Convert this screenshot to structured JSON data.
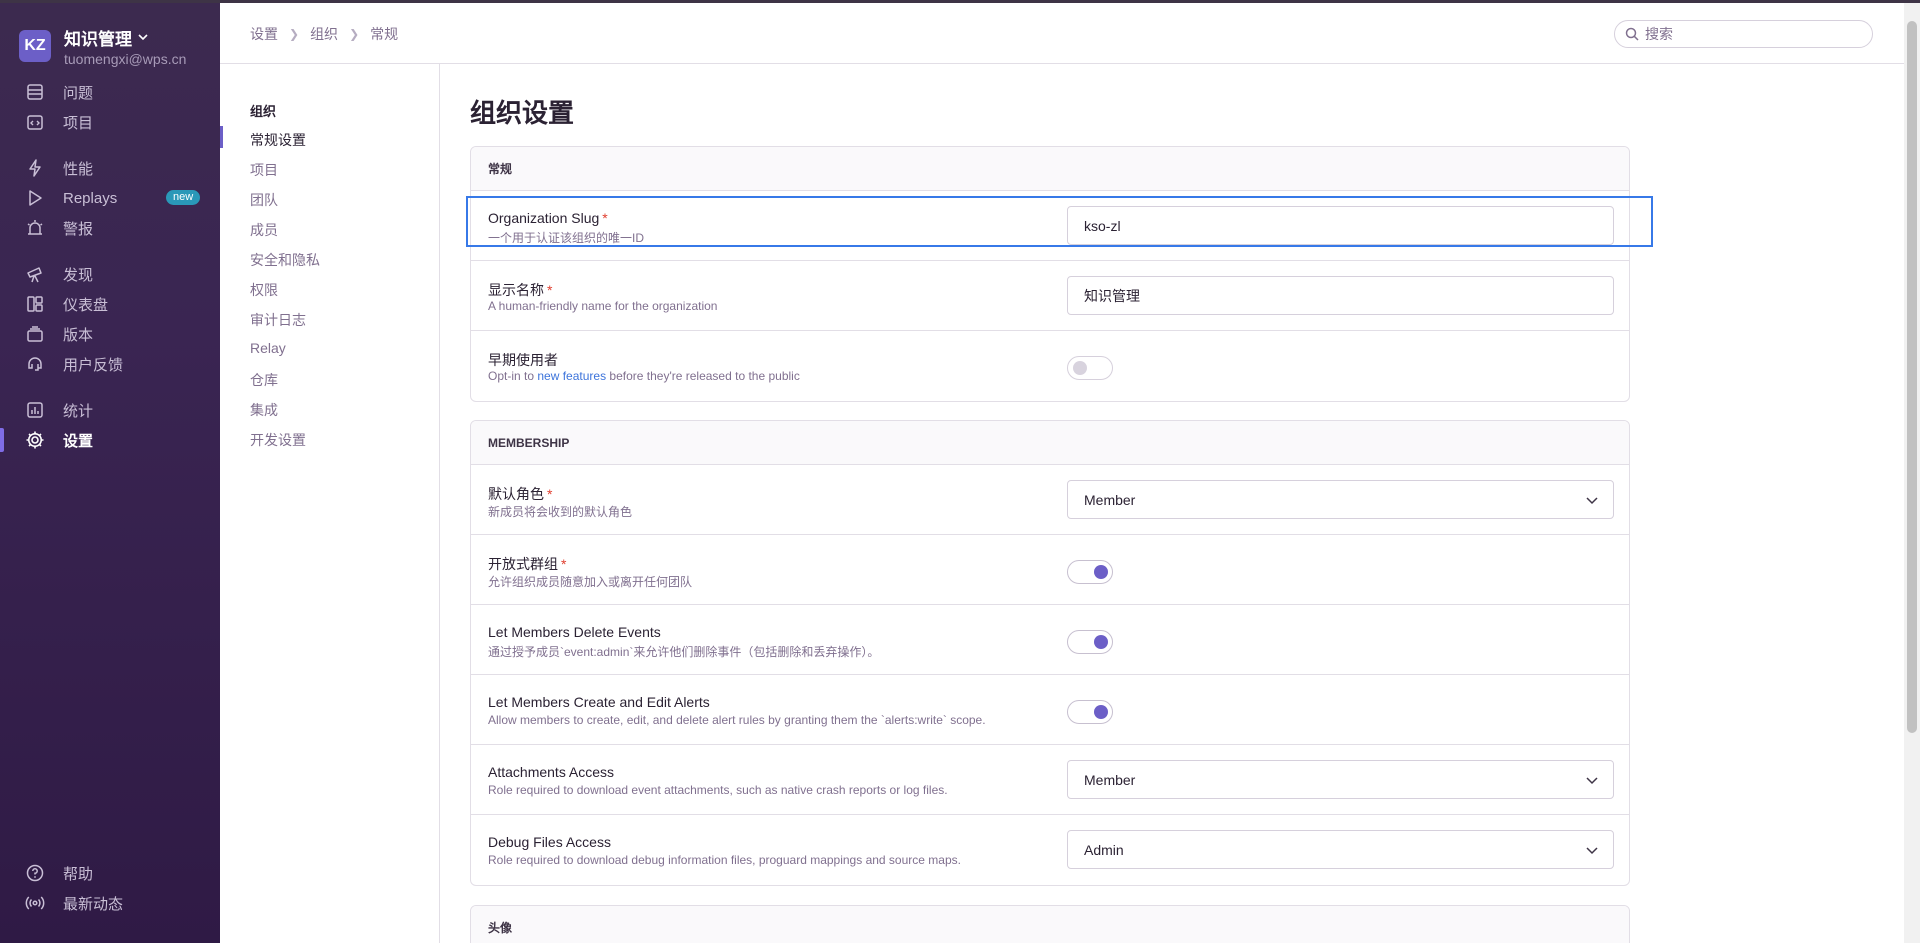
{
  "org": {
    "initials": "KZ",
    "name": "知识管理",
    "email": "tuomengxi@wps.cn"
  },
  "sidebar": {
    "items": [
      {
        "label": "问题",
        "icon": "issues-icon"
      },
      {
        "label": "项目",
        "icon": "projects-icon"
      },
      {
        "label": "性能",
        "icon": "lightning-icon"
      },
      {
        "label": "Replays",
        "icon": "play-icon",
        "badge": "new"
      },
      {
        "label": "警报",
        "icon": "siren-icon"
      },
      {
        "label": "发现",
        "icon": "telescope-icon"
      },
      {
        "label": "仪表盘",
        "icon": "dashboard-icon"
      },
      {
        "label": "版本",
        "icon": "releases-icon"
      },
      {
        "label": "用户反馈",
        "icon": "feedback-icon"
      },
      {
        "label": "统计",
        "icon": "stats-icon"
      },
      {
        "label": "设置",
        "icon": "gear-icon"
      }
    ],
    "bottom": [
      {
        "label": "帮助",
        "icon": "help-icon"
      },
      {
        "label": "最新动态",
        "icon": "broadcast-icon"
      }
    ],
    "active": "设置"
  },
  "header": {
    "breadcrumbs": [
      "设置",
      "组织",
      "常规"
    ],
    "search_placeholder": "搜索"
  },
  "subnav": {
    "group_title": "组织",
    "items": [
      "常规设置",
      "项目",
      "团队",
      "成员",
      "安全和隐私",
      "权限",
      "审计日志",
      "Relay",
      "仓库",
      "集成",
      "开发设置"
    ],
    "active": "常规设置"
  },
  "main": {
    "title": "组织设置",
    "general": {
      "heading": "常规",
      "slug": {
        "label": "Organization Slug",
        "help": "一个用于认证该组织的唯一ID",
        "value": "kso-zl"
      },
      "display_name": {
        "label": "显示名称",
        "help": "A human-friendly name for the organization",
        "value": "知识管理"
      },
      "early_adopter": {
        "label": "早期使用者",
        "help_prefix": "Opt-in to ",
        "help_link": "new features",
        "help_suffix": " before they're released to the public",
        "enabled": false
      }
    },
    "membership": {
      "heading": "MEMBERSHIP",
      "default_role": {
        "label": "默认角色",
        "help": "新成员将会收到的默认角色",
        "value": "Member"
      },
      "open_membership": {
        "label": "开放式群组",
        "help": "允许组织成员随意加入或离开任何团队",
        "enabled": true
      },
      "delete_events": {
        "label": "Let Members Delete Events",
        "help": "通过授予成员`event:admin`来允许他们删除事件（包括删除和丢弃操作）。",
        "enabled": true
      },
      "edit_alerts": {
        "label": "Let Members Create and Edit Alerts",
        "help": "Allow members to create, edit, and delete alert rules by granting them the `alerts:write` scope.",
        "enabled": true
      },
      "attachments_access": {
        "label": "Attachments Access",
        "help": "Role required to download event attachments, such as native crash reports or log files.",
        "value": "Member"
      },
      "debug_files_access": {
        "label": "Debug Files Access",
        "help": "Role required to download debug information files, proguard mappings and source maps.",
        "value": "Admin"
      }
    },
    "avatar_heading": "头像"
  },
  "colors": {
    "sidebar_bg": "#3a2552",
    "accent": "#6c5fc7",
    "focus": "#3779e8",
    "required": "#e03e2f"
  }
}
